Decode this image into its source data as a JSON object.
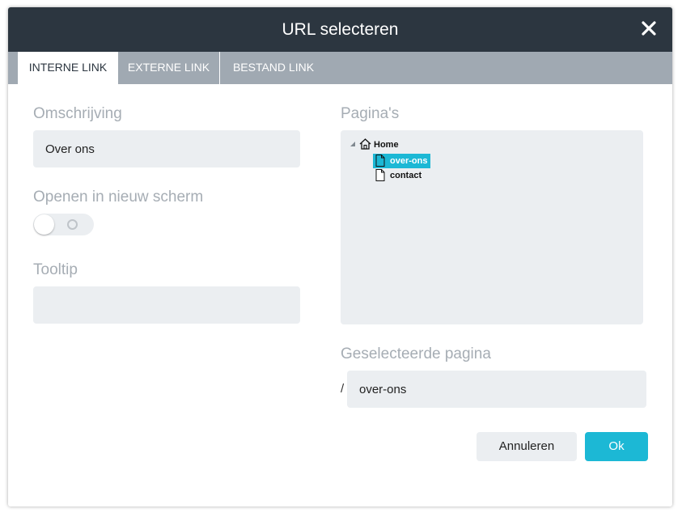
{
  "dialog": {
    "title": "URL selecteren"
  },
  "tabs": [
    {
      "label": "Interne link",
      "active": true
    },
    {
      "label": "Externe link",
      "active": false
    },
    {
      "label": "Bestand link",
      "active": false
    }
  ],
  "form": {
    "description_label": "Omschrijving",
    "description_value": "Over ons",
    "new_window_label": "Openen in nieuw scherm",
    "new_window_on": false,
    "tooltip_label": "Tooltip",
    "tooltip_value": ""
  },
  "pages": {
    "label": "Pagina's",
    "tree": [
      {
        "label": "Home",
        "icon": "home-icon",
        "expanded": true
      },
      {
        "label": "over-ons",
        "icon": "page-icon",
        "selected": true
      },
      {
        "label": "contact",
        "icon": "page-icon",
        "selected": false
      }
    ]
  },
  "selected": {
    "label": "Geselecteerde pagina",
    "prefix": "/",
    "value": "over-ons"
  },
  "buttons": {
    "cancel": "Annuleren",
    "ok": "Ok"
  },
  "colors": {
    "header": "#2c3640",
    "tabbar": "#a0a9b2",
    "accent": "#1cb8d5",
    "field": "#ebeef1",
    "label": "#a6adb4"
  }
}
